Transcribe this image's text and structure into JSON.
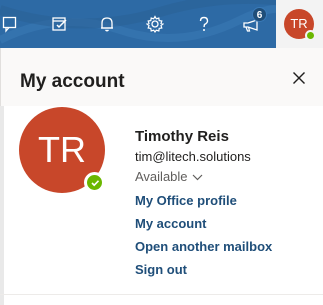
{
  "topbar": {
    "bg_color": "#2d6aa5",
    "buttons": [
      {
        "name": "my-day-icon"
      },
      {
        "name": "tasks-icon"
      },
      {
        "name": "notifications-bell-icon"
      },
      {
        "name": "settings-gear-icon"
      },
      {
        "name": "help-question-icon"
      },
      {
        "name": "whats-new-megaphone-icon"
      }
    ],
    "badge_count": "6",
    "user_initials": "TR",
    "presence_color": "#6bb700"
  },
  "panel": {
    "title": "My account",
    "close_icon": "close-icon"
  },
  "account": {
    "initials": "TR",
    "avatar_color": "#c8472a",
    "name": "Timothy Reis",
    "email": "tim@litech.solutions",
    "status": "Available",
    "links": [
      "My Office profile",
      "My account",
      "Open another mailbox",
      "Sign out"
    ]
  }
}
